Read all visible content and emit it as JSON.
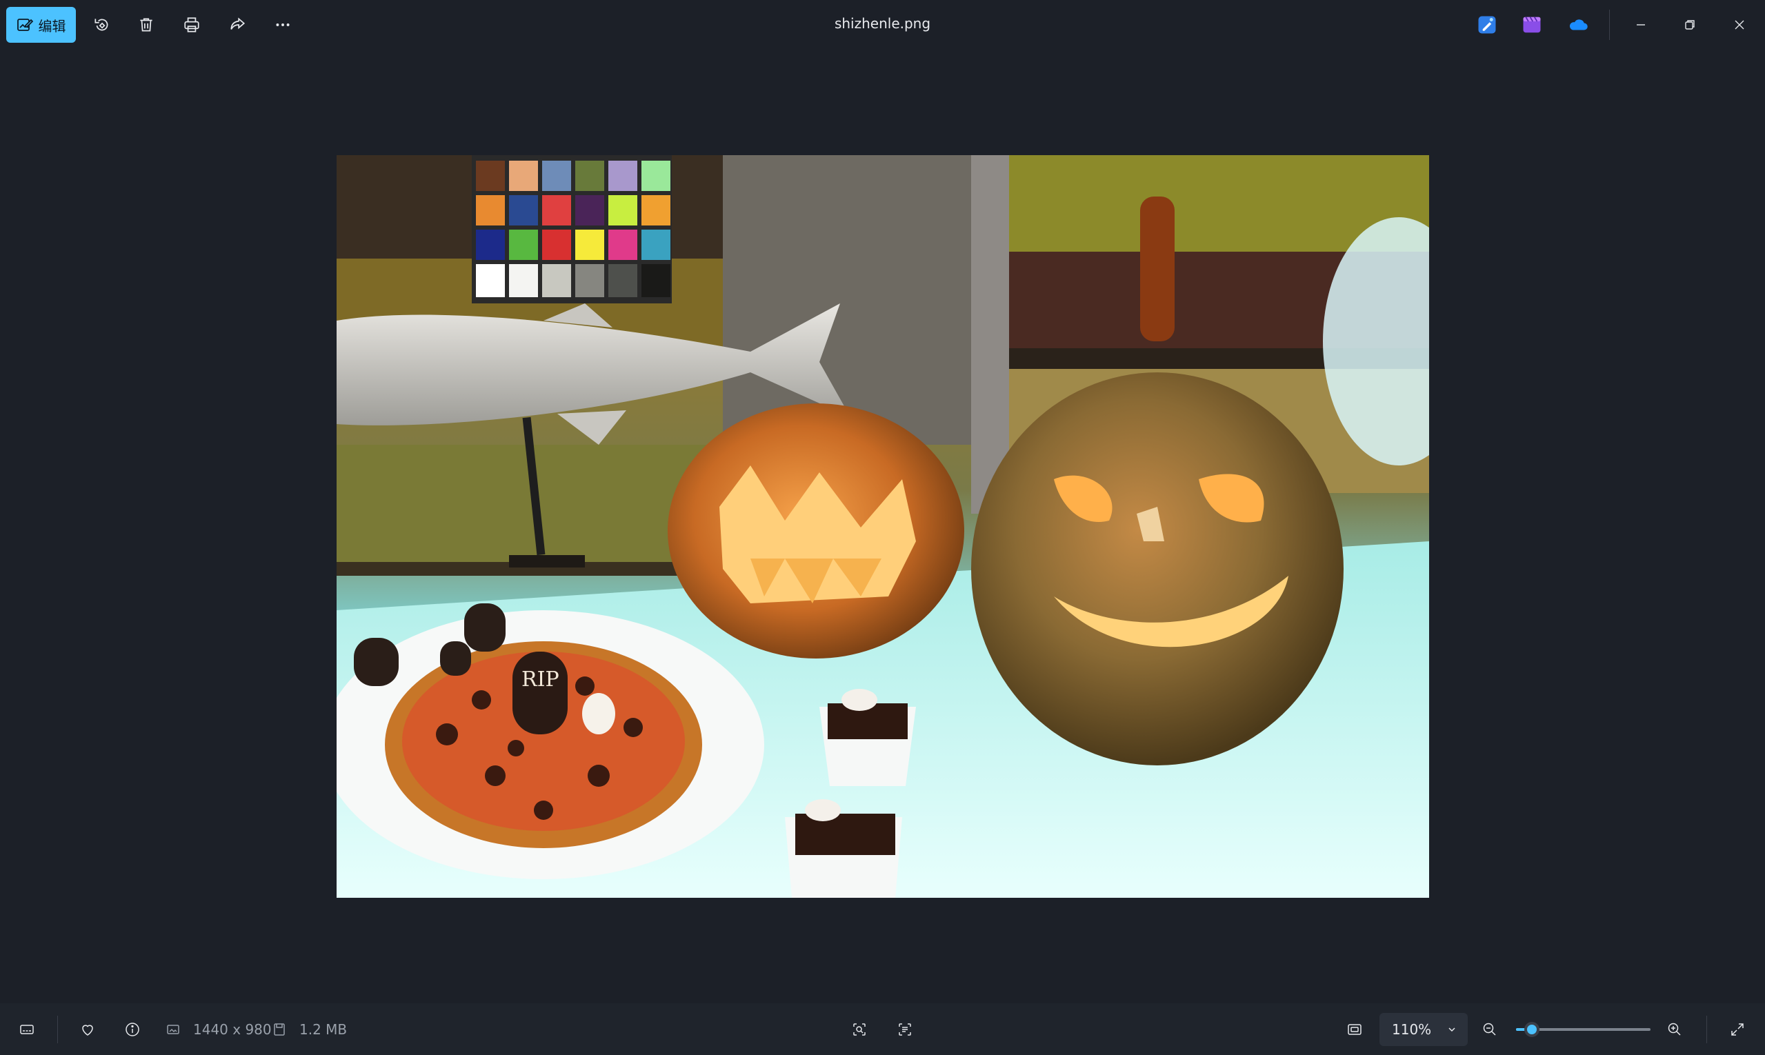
{
  "window": {
    "title": "shizhenle.png"
  },
  "toolbar": {
    "edit_label": "编辑",
    "edit_icon": "edit-image-icon",
    "tools": [
      {
        "name": "rotate-icon"
      },
      {
        "name": "delete-icon"
      },
      {
        "name": "print-icon"
      },
      {
        "name": "share-icon"
      },
      {
        "name": "more-options-icon"
      }
    ],
    "apps": [
      "designer-icon",
      "clipchamp-icon",
      "onedrive-icon"
    ],
    "accent": "#4cc2ff"
  },
  "photo": {
    "description_icon": "halloween-photo",
    "tombstone_text": "RIP"
  },
  "statusbar": {
    "dimensions": "1440 x 980",
    "file_size": "1.2 MB",
    "zoom_level": "110%",
    "zoom_fraction": 0.12
  }
}
